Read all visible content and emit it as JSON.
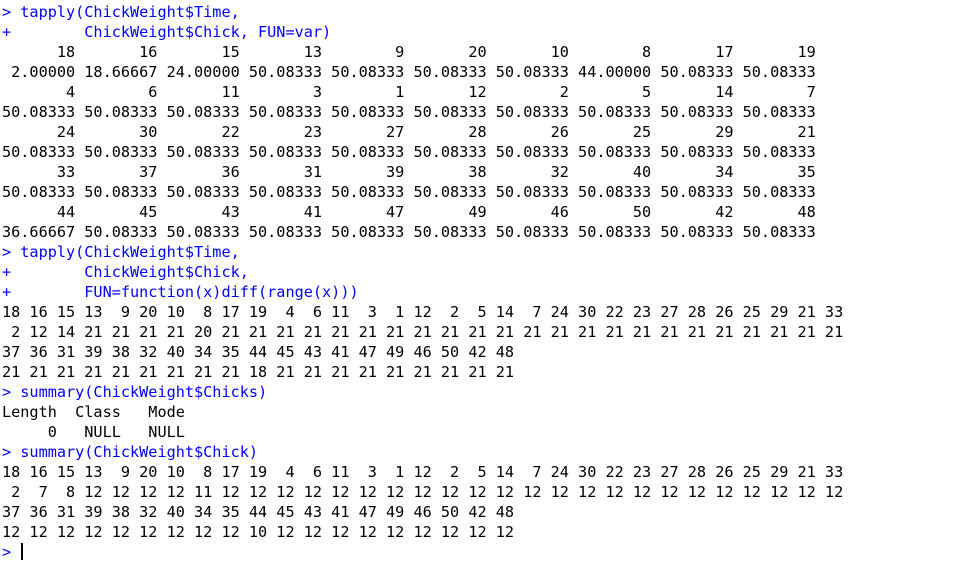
{
  "console": {
    "lines": [
      {
        "kind": "cmd",
        "text": "> tapply(ChickWeight$Time,"
      },
      {
        "kind": "cmd",
        "text": "+        ChickWeight$Chick, FUN=var)"
      },
      {
        "kind": "out",
        "text": "      18       16       15       13        9       20       10        8       17       19"
      },
      {
        "kind": "out",
        "text": " 2.00000 18.66667 24.00000 50.08333 50.08333 50.08333 50.08333 44.00000 50.08333 50.08333"
      },
      {
        "kind": "out",
        "text": "       4        6       11        3        1       12        2        5       14        7"
      },
      {
        "kind": "out",
        "text": "50.08333 50.08333 50.08333 50.08333 50.08333 50.08333 50.08333 50.08333 50.08333 50.08333"
      },
      {
        "kind": "out",
        "text": "      24       30       22       23       27       28       26       25       29       21"
      },
      {
        "kind": "out",
        "text": "50.08333 50.08333 50.08333 50.08333 50.08333 50.08333 50.08333 50.08333 50.08333 50.08333"
      },
      {
        "kind": "out",
        "text": "      33       37       36       31       39       38       32       40       34       35"
      },
      {
        "kind": "out",
        "text": "50.08333 50.08333 50.08333 50.08333 50.08333 50.08333 50.08333 50.08333 50.08333 50.08333"
      },
      {
        "kind": "out",
        "text": "      44       45       43       41       47       49       46       50       42       48"
      },
      {
        "kind": "out",
        "text": "36.66667 50.08333 50.08333 50.08333 50.08333 50.08333 50.08333 50.08333 50.08333 50.08333"
      },
      {
        "kind": "cmd",
        "text": "> tapply(ChickWeight$Time,"
      },
      {
        "kind": "cmd",
        "text": "+        ChickWeight$Chick,"
      },
      {
        "kind": "cmd",
        "text": "+        FUN=function(x)diff(range(x)))"
      },
      {
        "kind": "out",
        "text": "18 16 15 13  9 20 10  8 17 19  4  6 11  3  1 12  2  5 14  7 24 30 22 23 27 28 26 25 29 21 33"
      },
      {
        "kind": "out",
        "text": " 2 12 14 21 21 21 21 20 21 21 21 21 21 21 21 21 21 21 21 21 21 21 21 21 21 21 21 21 21 21 21"
      },
      {
        "kind": "out",
        "text": "37 36 31 39 38 32 40 34 35 44 45 43 41 47 49 46 50 42 48"
      },
      {
        "kind": "out",
        "text": "21 21 21 21 21 21 21 21 21 18 21 21 21 21 21 21 21 21 21"
      },
      {
        "kind": "cmd",
        "text": "> summary(ChickWeight$Chicks)"
      },
      {
        "kind": "out",
        "text": "Length  Class   Mode"
      },
      {
        "kind": "out",
        "text": "     0   NULL   NULL"
      },
      {
        "kind": "cmd",
        "text": "> summary(ChickWeight$Chick)"
      },
      {
        "kind": "out",
        "text": "18 16 15 13  9 20 10  8 17 19  4  6 11  3  1 12  2  5 14  7 24 30 22 23 27 28 26 25 29 21 33"
      },
      {
        "kind": "out",
        "text": " 2  7  8 12 12 12 12 11 12 12 12 12 12 12 12 12 12 12 12 12 12 12 12 12 12 12 12 12 12 12 12"
      },
      {
        "kind": "out",
        "text": "37 36 31 39 38 32 40 34 35 44 45 43 41 47 49 46 50 42 48"
      },
      {
        "kind": "out",
        "text": "12 12 12 12 12 12 12 12 12 10 12 12 12 12 12 12 12 12 12"
      }
    ],
    "prompt": "> "
  },
  "colors": {
    "command": "#0000ff",
    "output": "#000000",
    "background": "#ffffff"
  }
}
